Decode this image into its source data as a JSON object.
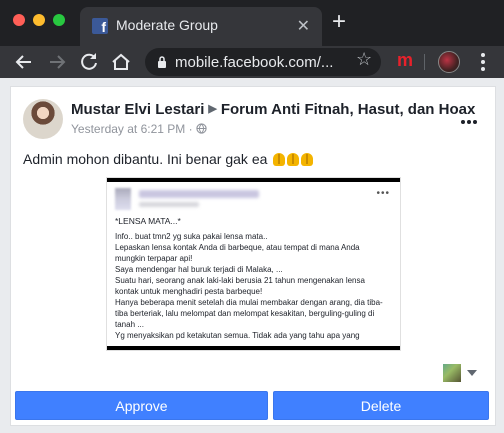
{
  "browser": {
    "tab_title": "Moderate Group",
    "tab_close": "✕",
    "new_tab": "+",
    "url": "mobile.facebook.com/...",
    "extension_label": "m",
    "favicon_letter": "f"
  },
  "post": {
    "author": "Mustar Elvi Lestari",
    "group": "Forum Anti Fitnah, Hasut, dan Hoax",
    "timestamp": "Yesterday at 6:21 PM · ",
    "text": "Admin mohon dibantu. Ini benar gak ea",
    "emoji_name": "folded-hands-emoji"
  },
  "embedded_image": {
    "lines": [
      "*LENSA MATA...*",
      "",
      "Info.. buat tmn2 yg suka pakai lensa mata..",
      "Lepaskan lensa kontak Anda di barbeque, atau tempat di mana Anda",
      "mungkin terpapar api!",
      "Saya mendengar hal buruk terjadi di Malaka, ...",
      "Suatu hari, seorang anak laki-laki berusia 21 tahun mengenakan lensa",
      "kontak untuk menghadiri pesta barbeque!",
      "Hanya beberapa menit setelah dia mulai membakar dengan arang, dia tiba-",
      "tiba berteriak, lalu melompat dan melompat kesakitan, berguling-guling di",
      "tanah ...",
      "Yg menyaksikan pd ketakutan semua. Tidak ada yang tahu apa yang"
    ],
    "dots": "•••"
  },
  "actions": {
    "approve_label": "Approve",
    "delete_label": "Delete"
  }
}
